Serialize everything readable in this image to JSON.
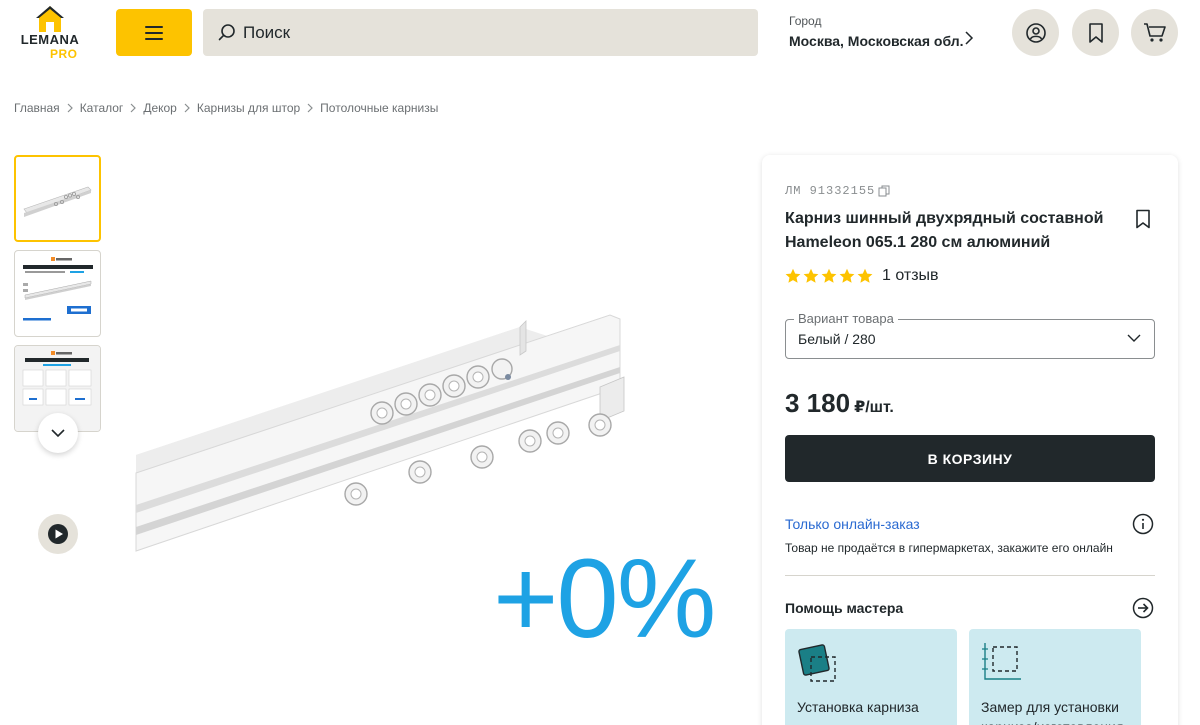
{
  "header": {
    "logo_text": "LEMANA",
    "logo_sub": "PRO",
    "search_placeholder": "Поиск",
    "city_label": "Город",
    "city_value": "Москва, Московская обл.",
    "icons": [
      "menu-icon",
      "search-icon",
      "chevron-right-icon",
      "user-icon",
      "bookmark-icon",
      "cart-icon"
    ],
    "accent_color": "#fdc300"
  },
  "breadcrumbs": [
    "Главная",
    "Каталог",
    "Декор",
    "Карнизы для штор",
    "Потолочные карнизы"
  ],
  "gallery": {
    "thumbnails": [
      {
        "alt": "Карниз — фото товара"
      },
      {
        "brand": "hameleon",
        "title": "КАРНИЗ ПОТОЛОЧНЫЙ",
        "badge": "280 см"
      },
      {
        "brand": "hameleon",
        "title": "КОМПЛЕКТАЦИЯ"
      }
    ],
    "promo_text": "+0%"
  },
  "product": {
    "sku_label": "ЛМ",
    "sku": "91332155",
    "title": "Карниз шинный двухрядный составной Hameleon 065.1 280 см алюминий",
    "rating": 5,
    "reviews": "1 отзыв",
    "variant_label": "Вариант товара",
    "variant_value": "Белый / 280",
    "price": "3 180",
    "price_unit": "₽/шт.",
    "cart_button": "В КОРЗИНУ",
    "online_title": "Только онлайн-заказ",
    "online_note": "Товар не продаётся в гипермаркетах, закажите его онлайн",
    "help_title": "Помощь мастера",
    "services": [
      {
        "label": "Установка карниза"
      },
      {
        "label": "Замер для установки карниза/изготовления"
      }
    ]
  }
}
